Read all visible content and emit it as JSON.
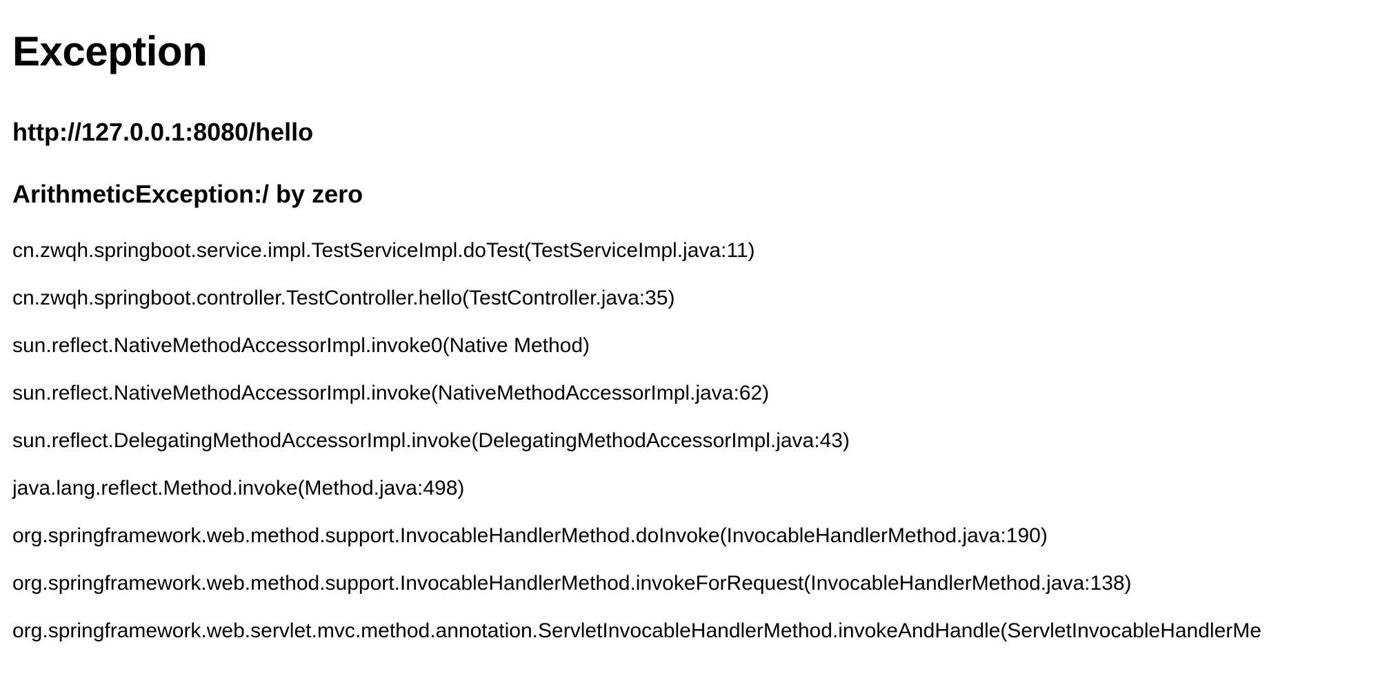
{
  "title": "Exception",
  "url": "http://127.0.0.1:8080/hello",
  "exception_message": "ArithmeticException:/ by zero",
  "stack_trace": [
    "cn.zwqh.springboot.service.impl.TestServiceImpl.doTest(TestServiceImpl.java:11)",
    "cn.zwqh.springboot.controller.TestController.hello(TestController.java:35)",
    "sun.reflect.NativeMethodAccessorImpl.invoke0(Native Method)",
    "sun.reflect.NativeMethodAccessorImpl.invoke(NativeMethodAccessorImpl.java:62)",
    "sun.reflect.DelegatingMethodAccessorImpl.invoke(DelegatingMethodAccessorImpl.java:43)",
    "java.lang.reflect.Method.invoke(Method.java:498)",
    "org.springframework.web.method.support.InvocableHandlerMethod.doInvoke(InvocableHandlerMethod.java:190)",
    "org.springframework.web.method.support.InvocableHandlerMethod.invokeForRequest(InvocableHandlerMethod.java:138)",
    "org.springframework.web.servlet.mvc.method.annotation.ServletInvocableHandlerMethod.invokeAndHandle(ServletInvocableHandlerMe"
  ]
}
